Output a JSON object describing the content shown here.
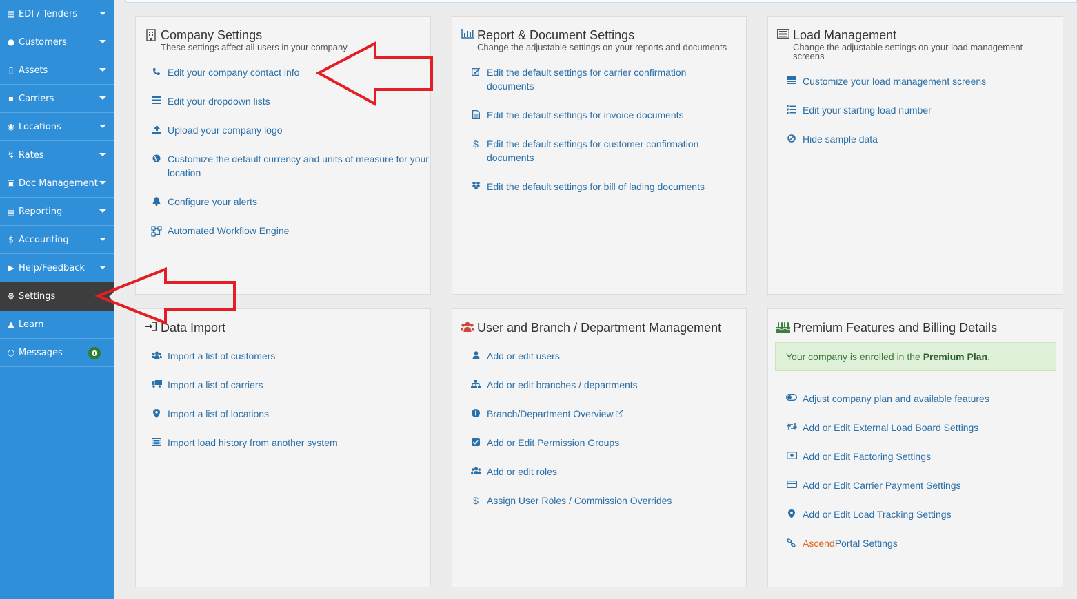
{
  "sidebar": {
    "items": [
      {
        "label": "EDI / Tenders",
        "icon": "inbox-icon"
      },
      {
        "label": "Customers",
        "icon": "users-icon"
      },
      {
        "label": "Assets",
        "icon": "barcode-icon"
      },
      {
        "label": "Carriers",
        "icon": "truck-icon"
      },
      {
        "label": "Locations",
        "icon": "map-marker-icon"
      },
      {
        "label": "Rates",
        "icon": "bolt-icon"
      },
      {
        "label": "Doc Management",
        "icon": "file-icon"
      },
      {
        "label": "Reporting",
        "icon": "file-text-icon"
      },
      {
        "label": "Accounting",
        "icon": "dollar-icon"
      },
      {
        "label": "Help/Feedback",
        "icon": "bullhorn-icon"
      },
      {
        "label": "Settings",
        "icon": "cogs-icon"
      },
      {
        "label": "Learn",
        "icon": "graduation-cap-icon"
      },
      {
        "label": "Messages",
        "icon": "comment-icon",
        "badge": "0"
      }
    ],
    "active": "Settings"
  },
  "company_settings": {
    "title": "Company Settings",
    "subtitle": "These settings affect all users in your company",
    "links": [
      "Edit your company contact info",
      "Edit your dropdown lists",
      "Upload your company logo",
      "Customize the default currency and units of measure for your location",
      "Configure your alerts",
      "Automated Workflow Engine"
    ]
  },
  "report_settings": {
    "title": "Report & Document Settings",
    "subtitle": "Change the adjustable settings on your reports and documents",
    "links": [
      "Edit the default settings for carrier confirmation documents",
      "Edit the default settings for invoice documents",
      "Edit the default settings for customer confirmation documents",
      "Edit the default settings for bill of lading documents"
    ]
  },
  "load_management": {
    "title": "Load Management",
    "subtitle": "Change the adjustable settings on your load management screens",
    "links": [
      "Customize your load management screens",
      "Edit your starting load number",
      "Hide sample data"
    ]
  },
  "data_import": {
    "title": "Data Import",
    "links": [
      "Import a list of customers",
      "Import a list of carriers",
      "Import a list of locations",
      "Import load history from another system"
    ]
  },
  "user_management": {
    "title": "User and Branch / Department Management",
    "links": [
      "Add or edit users",
      "Add or edit branches / departments",
      "Branch/Department Overview",
      "Add or Edit Permission Groups",
      "Add or edit roles",
      "Assign User Roles / Commission Overrides"
    ]
  },
  "premium": {
    "title": "Premium Features and Billing Details",
    "alert_prefix": "Your company is enrolled in the ",
    "plan_name": "Premium Plan",
    "alert_suffix": ".",
    "links": [
      "Adjust company plan and available features",
      "Add or Edit External Load Board Settings",
      "Add or Edit Factoring Settings",
      "Add or Edit Carrier Payment Settings",
      "Add or Edit Load Tracking Settings"
    ],
    "portal_brand": "Ascend",
    "portal_rest": "Portal Settings"
  },
  "colors": {
    "sidebar": "#2f8fd8",
    "active_item": "#3d3d3d",
    "link": "#2a6fa8",
    "annotation_arrow": "#e31e24",
    "alert_bg": "#dff0d8"
  }
}
